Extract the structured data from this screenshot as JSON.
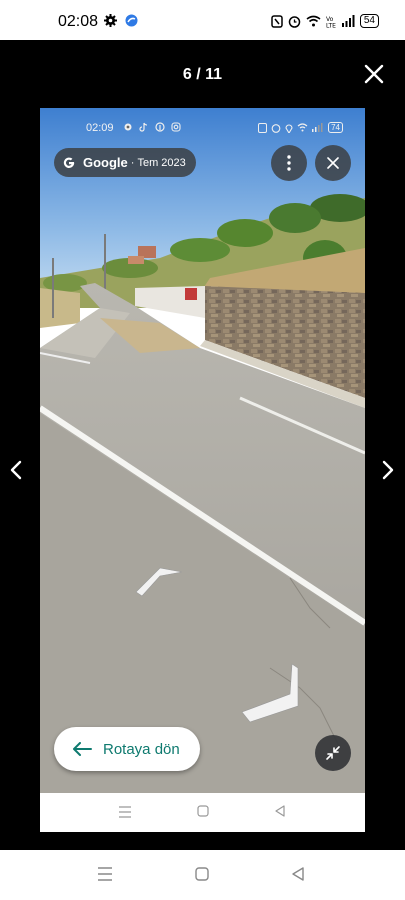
{
  "status_bar": {
    "time": "02:08",
    "battery": "54",
    "left_icons": [
      "gear-icon",
      "app-icon"
    ],
    "right_icons": [
      "nfc-icon",
      "alarm-icon",
      "wifi-icon",
      "volte-icon",
      "signal-icon",
      "battery-icon"
    ]
  },
  "viewer": {
    "counter": "6 / 11",
    "close_icon": "close-icon",
    "prev_icon": "chevron-left-icon",
    "next_icon": "chevron-right-icon"
  },
  "inner_status_bar": {
    "time": "02:09",
    "battery": "74"
  },
  "street_view": {
    "brand": "Google",
    "separator": "·",
    "date": "Tem 2023",
    "route_button": "Rotaya dön",
    "accent_color": "#0e7a6f"
  },
  "nav_bar": {
    "icons": [
      "menu-icon",
      "home-icon",
      "back-icon"
    ]
  }
}
